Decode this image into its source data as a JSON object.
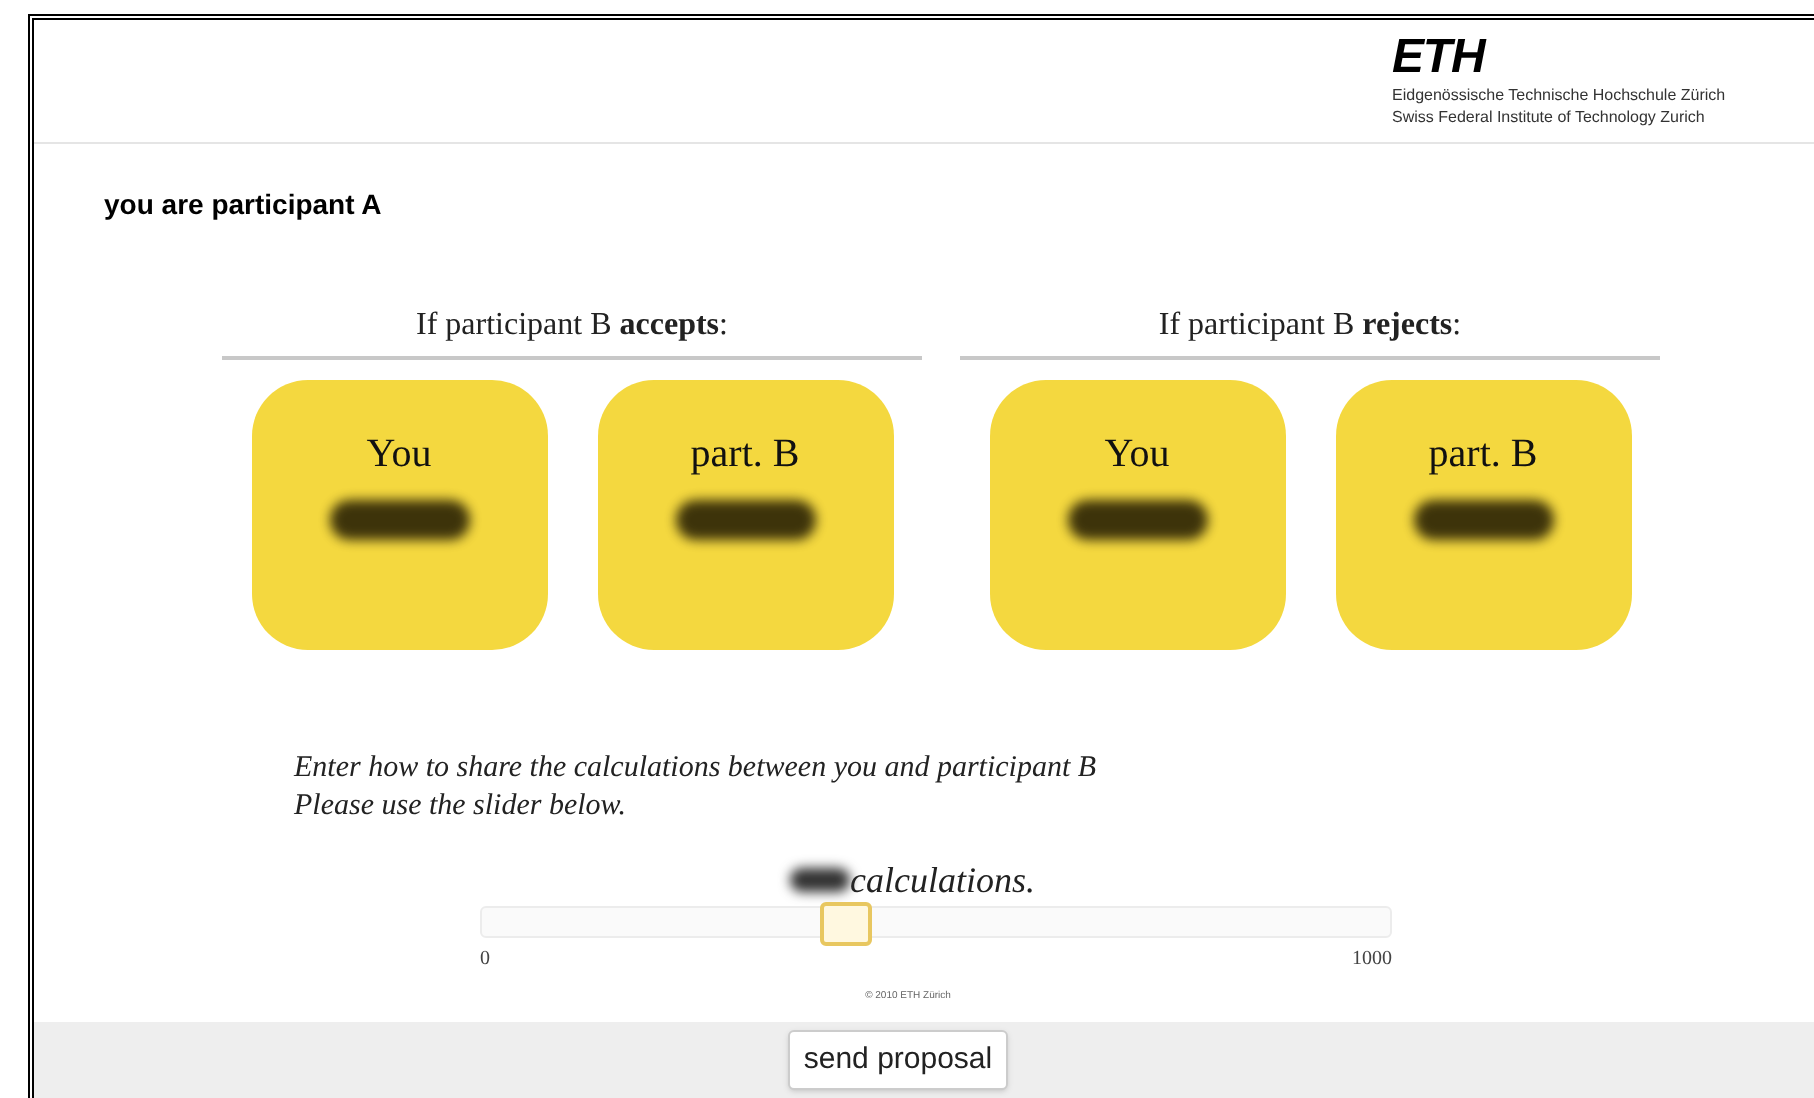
{
  "logo": {
    "wordmark": "ETH",
    "line_1": "Eidgenössische Technische Hochschule Zürich",
    "line_2": "Swiss Federal Institute of Technology Zurich"
  },
  "participant_label": "you are participant A",
  "outcomes": [
    {
      "heading": "If participant B **accepts**:",
      "cards": [
        {
          "label": "You"
        },
        {
          "label": "part. B"
        }
      ]
    },
    {
      "heading": "If participant B **rejects**:",
      "cards": [
        {
          "label": "You"
        },
        {
          "label": "part. B"
        }
      ]
    }
  ],
  "instructions": [
    "Enter how to share the calculations between you and participant B",
    "Please use the slider below."
  ],
  "slider": {
    "unit_text": "calculations.",
    "level": 0.4,
    "min_label": "0",
    "max_label": "1000"
  },
  "copyright": "© 2010 ETH Zürich",
  "send_button": "send proposal"
}
